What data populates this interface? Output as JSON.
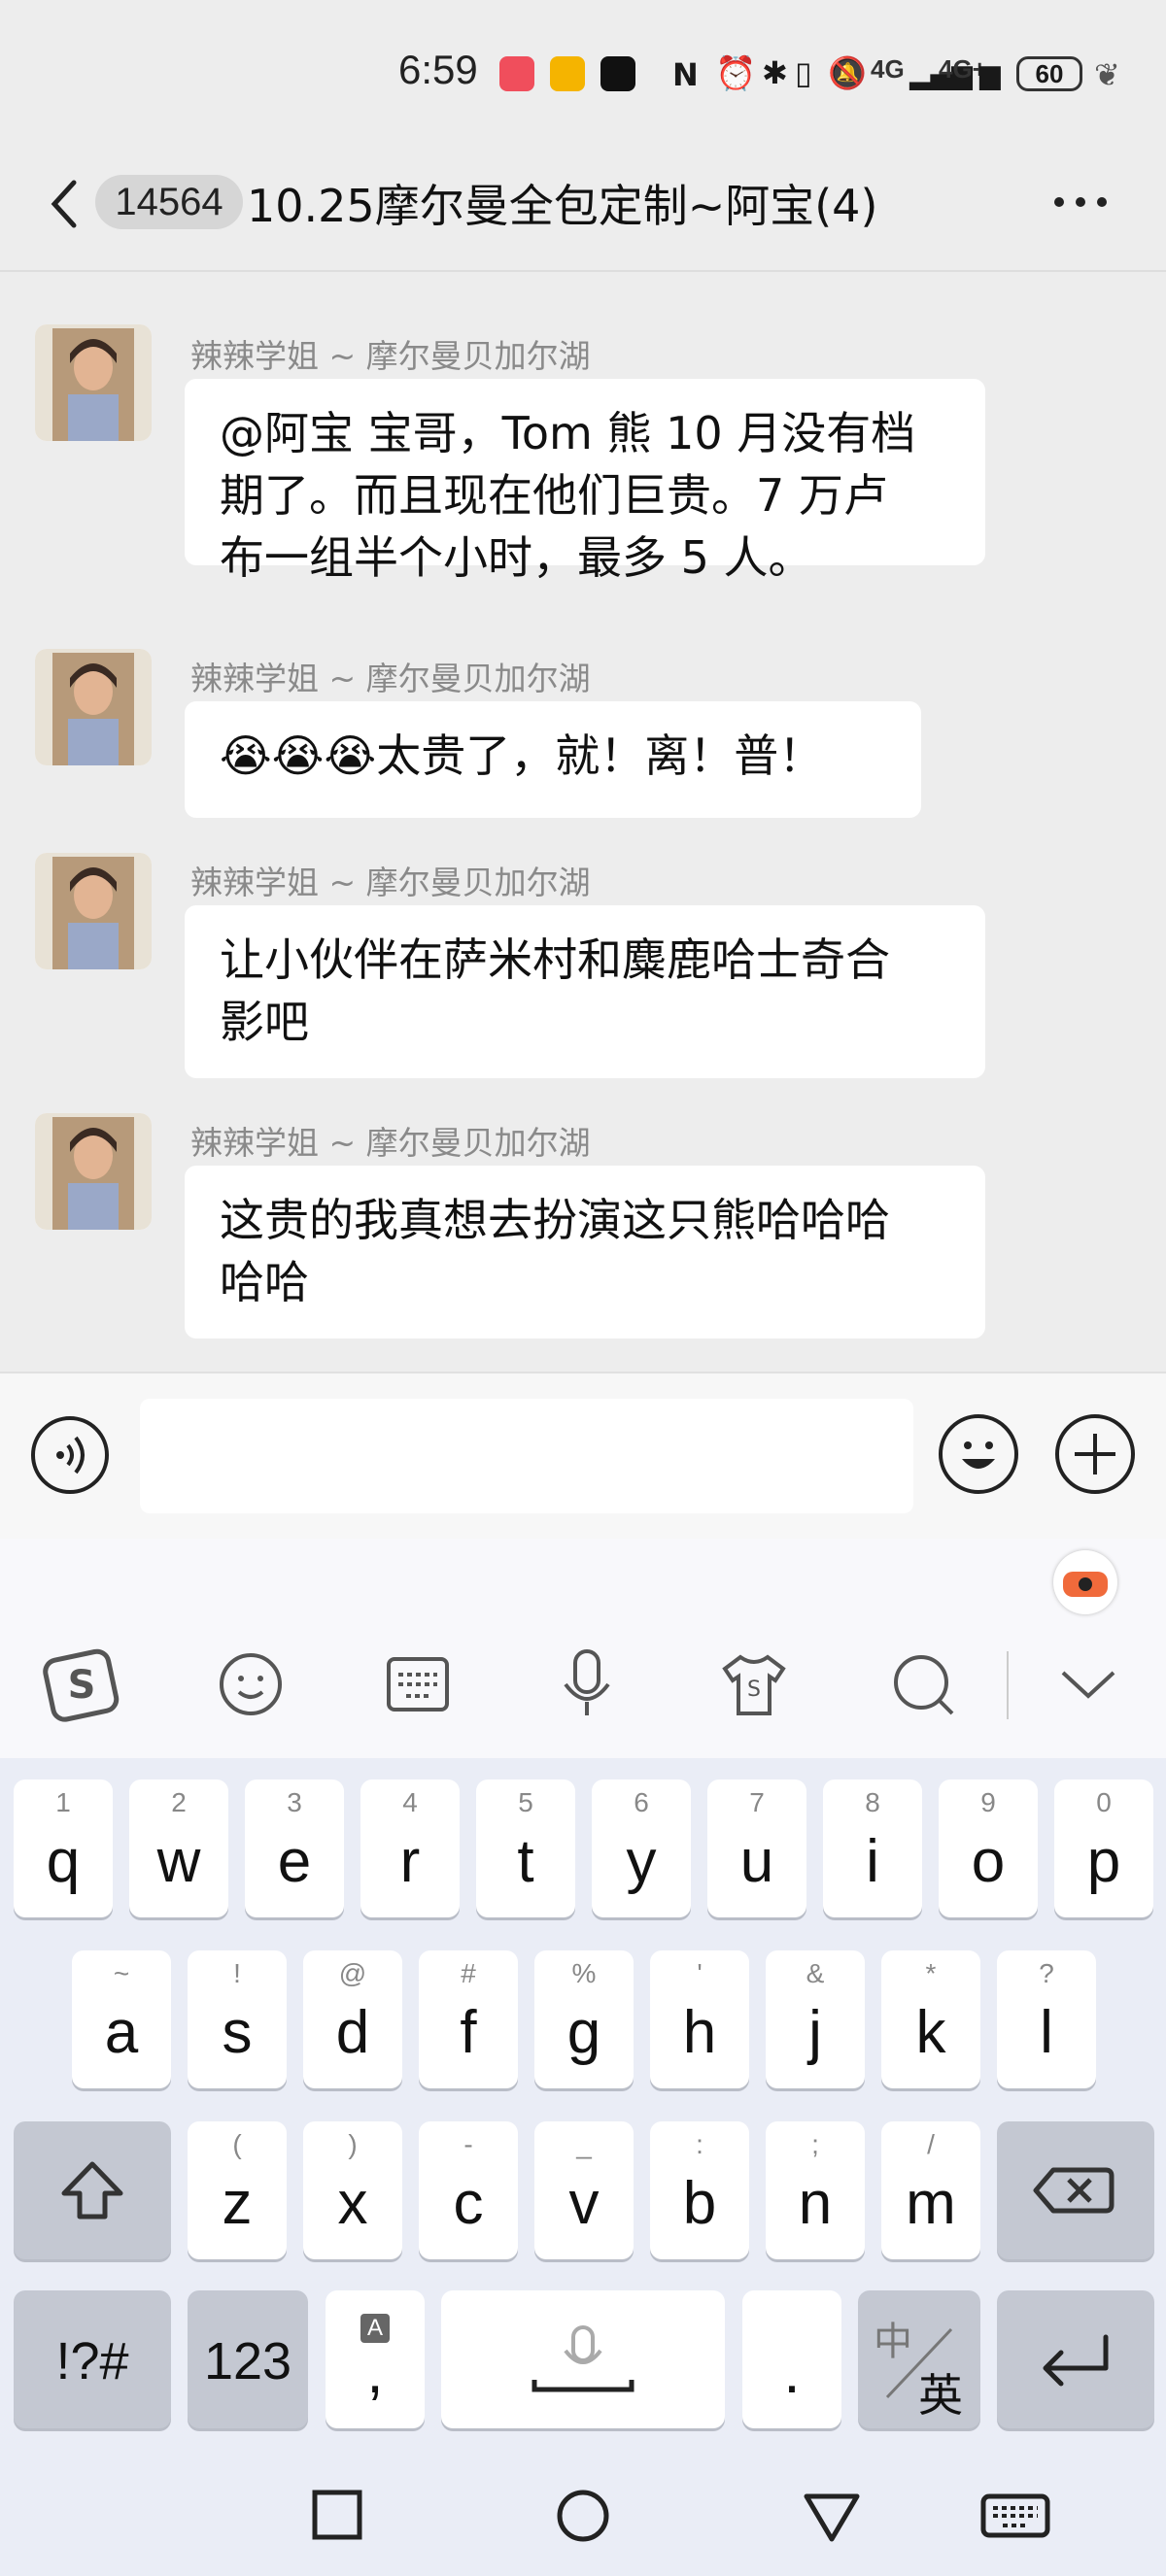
{
  "status_bar": {
    "time": "6:59",
    "network_1": "4G",
    "network_2": "4G+",
    "battery": "60"
  },
  "header": {
    "back_icon": "chevron-left-icon",
    "unread_count": "14564",
    "title": "10.25摩尔曼全包定制~阿宝(4)",
    "more_icon": "more-horizontal-icon"
  },
  "messages": [
    {
      "sender": "辣辣学姐 ~ 摩尔曼贝加尔湖",
      "lines": [
        "@阿宝  宝哥，Tom 熊 10 月没有档",
        "期了。而且现在他们巨贵。7 万卢",
        "布一组半个小时，最多 5 人。"
      ]
    },
    {
      "sender": "辣辣学姐 ~ 摩尔曼贝加尔湖",
      "lines": [
        "😭😭😭太贵了，就！离！普！"
      ]
    },
    {
      "sender": "辣辣学姐 ~ 摩尔曼贝加尔湖",
      "lines": [
        "让小伙伴在萨米村和麋鹿哈士奇合",
        "影吧"
      ]
    },
    {
      "sender": "辣辣学姐 ~ 摩尔曼贝加尔湖",
      "lines": [
        "这贵的我真想去扮演这只熊哈哈哈",
        "哈哈"
      ]
    }
  ],
  "input_bar": {
    "voice_icon": "voice-input-icon",
    "emoji_icon": "emoji-icon",
    "plus_icon": "plus-icon",
    "text_value": ""
  },
  "keyboard": {
    "toolbar_icons": [
      "sogou-logo-icon",
      "emoji-icon",
      "keyboard-icon",
      "microphone-icon",
      "skin-shirt-icon",
      "search-icon",
      "collapse-chevron-icon"
    ],
    "row1": [
      {
        "main": "q",
        "hint": "1"
      },
      {
        "main": "w",
        "hint": "2"
      },
      {
        "main": "e",
        "hint": "3"
      },
      {
        "main": "r",
        "hint": "4"
      },
      {
        "main": "t",
        "hint": "5"
      },
      {
        "main": "y",
        "hint": "6"
      },
      {
        "main": "u",
        "hint": "7"
      },
      {
        "main": "i",
        "hint": "8"
      },
      {
        "main": "o",
        "hint": "9"
      },
      {
        "main": "p",
        "hint": "0"
      }
    ],
    "row2": [
      {
        "main": "a",
        "hint": "~"
      },
      {
        "main": "s",
        "hint": "!"
      },
      {
        "main": "d",
        "hint": "@"
      },
      {
        "main": "f",
        "hint": "#"
      },
      {
        "main": "g",
        "hint": "%"
      },
      {
        "main": "h",
        "hint": "'"
      },
      {
        "main": "j",
        "hint": "&"
      },
      {
        "main": "k",
        "hint": "*"
      },
      {
        "main": "l",
        "hint": "?"
      }
    ],
    "row3": [
      {
        "main": "z",
        "hint": "("
      },
      {
        "main": "x",
        "hint": ")"
      },
      {
        "main": "c",
        "hint": "-"
      },
      {
        "main": "v",
        "hint": "_"
      },
      {
        "main": "b",
        "hint": ":"
      },
      {
        "main": "n",
        "hint": ";"
      },
      {
        "main": "m",
        "hint": "/"
      }
    ],
    "symbols_label": "!?#",
    "numbers_label": "123",
    "comma_label": ",",
    "comma_hint": "A",
    "period_label": ".",
    "lang_top": "中",
    "lang_bottom": "英",
    "shift_icon": "shift-icon",
    "backspace_icon": "backspace-icon",
    "enter_icon": "enter-icon",
    "space_icon": "space-mic-icon"
  },
  "nav_bar": {
    "recent_icon": "recents-square-icon",
    "home_icon": "home-circle-icon",
    "back_icon": "back-triangle-icon",
    "keyboard_icon": "keyboard-switch-icon"
  }
}
